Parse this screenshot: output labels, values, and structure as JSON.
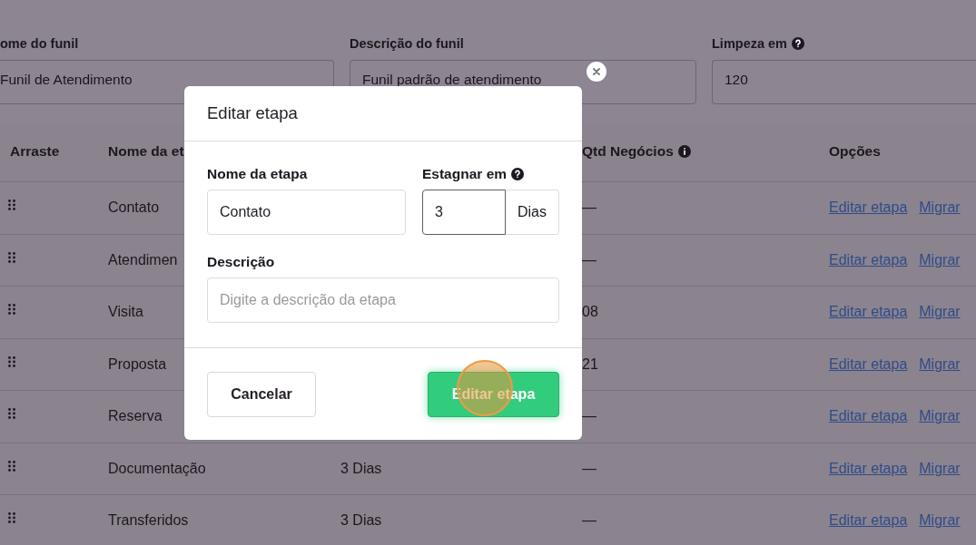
{
  "funnel_form": {
    "fields": [
      {
        "label": "ome do funil",
        "help_icon": false,
        "value": "Funil de Atendimento"
      },
      {
        "label": "Descrição do funil",
        "help_icon": false,
        "value": "Funil padrão de atendimento"
      },
      {
        "label": "Limpeza em",
        "help_icon": true,
        "value": "120"
      }
    ]
  },
  "table": {
    "columns": [
      {
        "label": "Arraste",
        "info_icon": false
      },
      {
        "label": "Nome da et",
        "info_icon": false
      },
      {
        "label": "Qtd Negócios",
        "info_icon": true
      },
      {
        "label": "Opções",
        "info_icon": false
      }
    ],
    "rows": [
      {
        "name": "Contato",
        "deals": "—",
        "actions": [
          "Editar etapa",
          "Migrar"
        ]
      },
      {
        "name": "Atendimen",
        "deals": "—",
        "actions": [
          "Editar etapa",
          "Migrar"
        ]
      },
      {
        "name": "Visita",
        "deals": "08",
        "actions": [
          "Editar etapa",
          "Migrar"
        ]
      },
      {
        "name": "Proposta",
        "deals": "21",
        "actions": [
          "Editar etapa",
          "Migrar"
        ]
      },
      {
        "name": "Reserva",
        "deals": "—",
        "actions": [
          "Editar etapa",
          "Migrar"
        ]
      },
      {
        "name": "Documentação",
        "stagnation": "3 Dias",
        "deals": "—",
        "actions": [
          "Editar etapa",
          "Migrar"
        ]
      },
      {
        "name": "Transferidos",
        "stagnation": "3 Dias",
        "deals": "—",
        "actions": [
          "Editar etapa",
          "Migrar"
        ]
      }
    ]
  },
  "modal": {
    "title": "Editar etapa",
    "name_field": {
      "label": "Nome da etapa",
      "value": "Contato"
    },
    "stagnation_field": {
      "label": "Estagnar em",
      "help_icon": true,
      "value": "3",
      "unit": "Dias"
    },
    "description_field": {
      "label": "Descrição",
      "placeholder": "Digite a descrição da etapa"
    },
    "buttons": [
      {
        "label": "Cancelar",
        "kind": "secondary"
      },
      {
        "label": "Editar etapa",
        "kind": "primary"
      }
    ]
  },
  "click_indicator": {
    "on": true
  }
}
